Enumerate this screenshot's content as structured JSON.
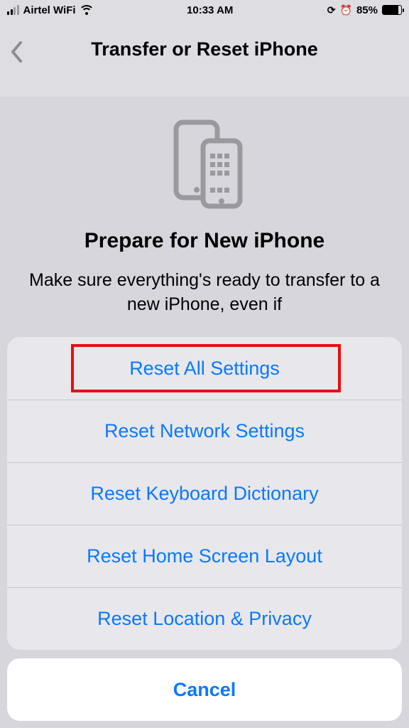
{
  "status": {
    "carrier": "Airtel WiFi",
    "time": "10:33 AM",
    "battery_pct": "85%"
  },
  "nav": {
    "title": "Transfer or Reset iPhone"
  },
  "body": {
    "heading": "Prepare for New iPhone",
    "description": "Make sure everything's ready to transfer to a new iPhone, even if"
  },
  "sheet": {
    "options": [
      "Reset All Settings",
      "Reset Network Settings",
      "Reset Keyboard Dictionary",
      "Reset Home Screen Layout",
      "Reset Location & Privacy"
    ],
    "cancel": "Cancel"
  }
}
